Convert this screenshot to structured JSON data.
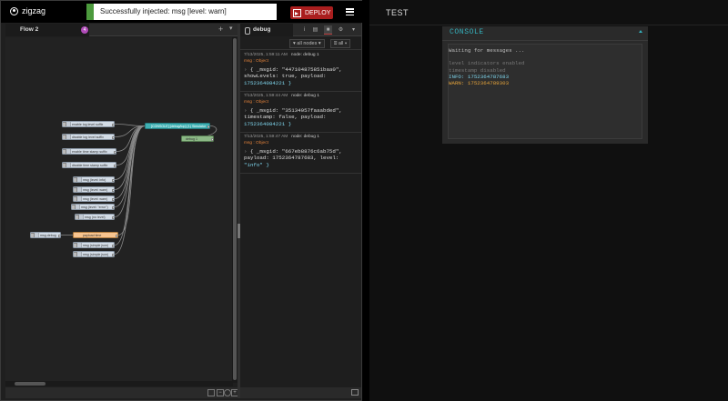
{
  "header": {
    "app_name": "zigzag",
    "toast": "Successfully injected: msg [level: warn]",
    "deploy_label": "DEPLOY"
  },
  "workspace": {
    "tab_label": "Flow 2",
    "badge": "4"
  },
  "flow": {
    "inject_nodes": [
      "enable log level suffix",
      "disable log level suffix",
      "enable time stamp suffix",
      "disable time stamp suffix",
      "msg (level: info)",
      "msg (level: warn)",
      "msg (level: warn)",
      "msg (level: \"error\")",
      "msg (no level)",
      "payload time",
      "msg (simple json)",
      "msg (simple json)"
    ],
    "msg_debug_label": "msg.debug",
    "ui_node_label": "[CONSOLE] [debug/top] (1) Simulator",
    "debug_node_label": "debug 1"
  },
  "sidebar": {
    "tab_label": "debug",
    "filter_label": "all nodes",
    "scope_label": "all",
    "messages": [
      {
        "time": "7/13/2025, 1:59:11 AM",
        "node": "node: debug 1",
        "type": "msg : Object",
        "line1": "{ _msgid: \"447104875851baa0\",",
        "line2": "showLevels: true, payload:",
        "line3": "1752364084221 }"
      },
      {
        "time": "7/13/2025, 1:59:44 AM",
        "node": "node: debug 1",
        "type": "msg : Object",
        "line1": "{ _msgid: \"35134057faaabded\",",
        "line2": "timestamp: false, payload:",
        "line3": "1752364084221 }"
      },
      {
        "time": "7/13/2025, 1:59:47 AM",
        "node": "node: debug 1",
        "type": "msg : Object",
        "line1": "{ _msgid: \"667eb8876c6ab75d\",",
        "line2": "payload: 1752364787683, level:",
        "line3": "\"info\" }"
      }
    ]
  },
  "dashboard": {
    "title": "TEST",
    "group_title": "CONSOLE",
    "console_lines": [
      {
        "text": "Waiting for messages ...",
        "kind": "wait"
      },
      {
        "text": "",
        "kind": "blank"
      },
      {
        "text": "level indicators enabled",
        "kind": "dim"
      },
      {
        "text": "timestamp disabled",
        "kind": "dim"
      },
      {
        "text": "INFO: 1752364787683",
        "kind": "info"
      },
      {
        "text": "WARN: 1752364789303",
        "kind": "warn"
      }
    ]
  },
  "colors": {
    "deploy": "#aa1e1e",
    "accent": "#35b1bd",
    "toast_bar": "#4c9a3d",
    "info": "#7fd6ee",
    "warn": "#e5a33a"
  }
}
